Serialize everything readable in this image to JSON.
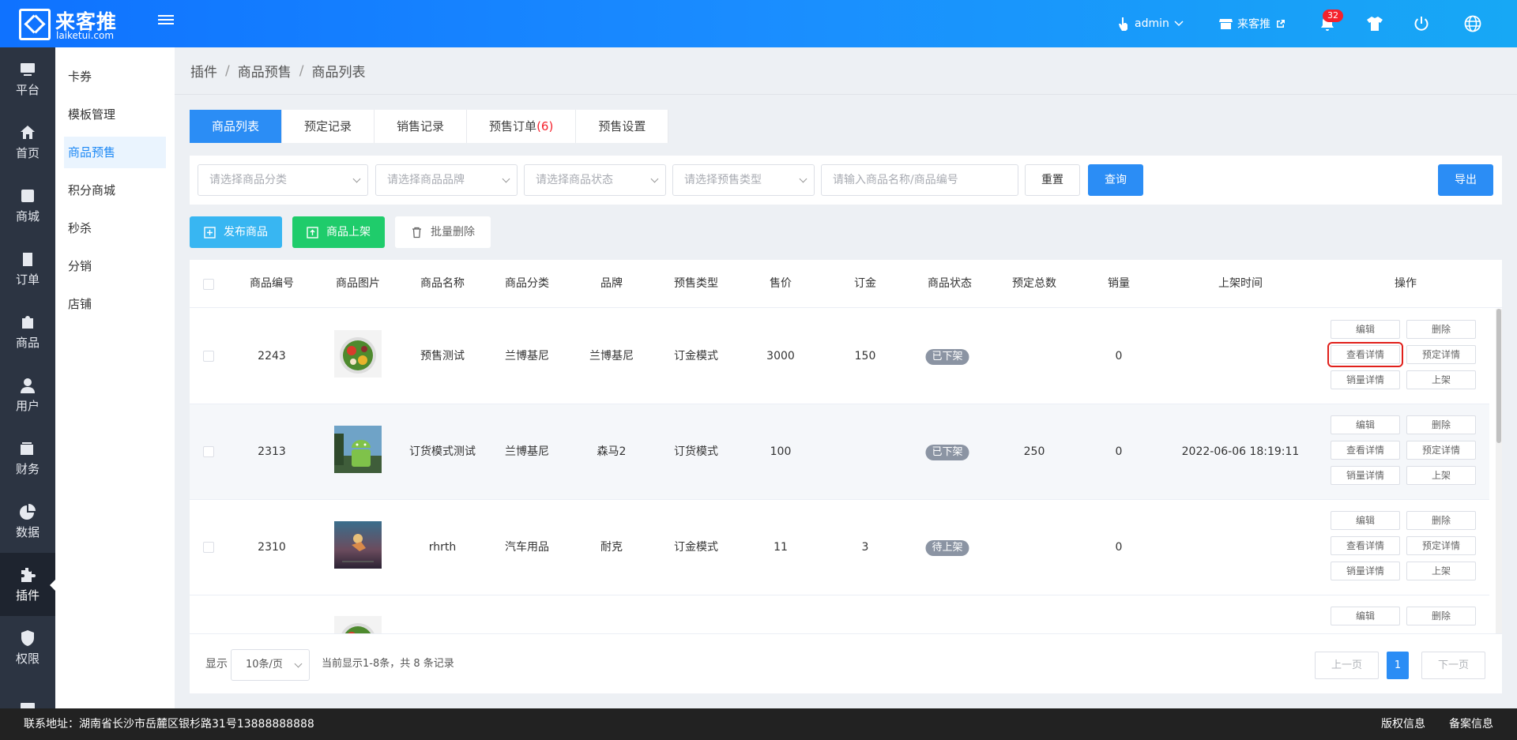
{
  "header": {
    "logo_cn": "来客推",
    "logo_en": "laiketui.com",
    "user": "admin",
    "store": "来客推",
    "notification_count": "32",
    "brand_gradient": [
      "#0f72ff",
      "#17a8f5"
    ]
  },
  "rail": [
    {
      "label": "平台",
      "icon": "platform-icon"
    },
    {
      "label": "首页",
      "icon": "home-icon"
    },
    {
      "label": "商城",
      "icon": "mall-icon"
    },
    {
      "label": "订单",
      "icon": "order-icon"
    },
    {
      "label": "商品",
      "icon": "goods-icon"
    },
    {
      "label": "用户",
      "icon": "user-icon"
    },
    {
      "label": "财务",
      "icon": "wallet-icon"
    },
    {
      "label": "数据",
      "icon": "pie-chart-icon"
    },
    {
      "label": "插件",
      "icon": "puzzle-icon"
    },
    {
      "label": "权限",
      "icon": "shield-icon"
    },
    {
      "label": "",
      "icon": "image-icon"
    }
  ],
  "submenu": [
    "卡券",
    "模板管理",
    "商品预售",
    "积分商城",
    "秒杀",
    "分销",
    "店铺"
  ],
  "breadcrumb": [
    "插件",
    "商品预售",
    "商品列表"
  ],
  "tabs": [
    {
      "label": "商品列表",
      "count": ""
    },
    {
      "label": "预定记录",
      "count": ""
    },
    {
      "label": "销售记录",
      "count": ""
    },
    {
      "label": "预售订单",
      "count": "(6)"
    },
    {
      "label": "预售设置",
      "count": ""
    }
  ],
  "filters": {
    "category": "请选择商品分类",
    "brand": "请选择商品品牌",
    "status": "请选择商品状态",
    "presale_type": "请选择预售类型",
    "keyword_placeholder": "请输入商品名称/商品编号",
    "reset": "重置",
    "query": "查询",
    "export": "导出"
  },
  "actions": {
    "publish": "发布商品",
    "shelve": "商品上架",
    "batch_delete": "批量删除"
  },
  "columns": [
    "商品编号",
    "商品图片",
    "商品名称",
    "商品分类",
    "品牌",
    "预售类型",
    "售价",
    "订金",
    "商品状态",
    "预定总数",
    "销量",
    "上架时间",
    "操作"
  ],
  "rows": [
    {
      "id": "2243",
      "name": "预售测试",
      "category": "兰博基尼",
      "brand": "兰博基尼",
      "type": "订金模式",
      "price": "3000",
      "deposit": "150",
      "status": "已下架",
      "reserved": "",
      "sales": "0",
      "time": "",
      "image": "salad-bowl"
    },
    {
      "id": "2313",
      "name": "订货模式测试",
      "category": "兰博基尼",
      "brand": "森马2",
      "type": "订货模式",
      "price": "100",
      "deposit": "",
      "status": "已下架",
      "reserved": "250",
      "sales": "0",
      "time": "2022-06-06 18:19:11",
      "image": "android-figure"
    },
    {
      "id": "2310",
      "name": "rhrth",
      "category": "汽车用品",
      "brand": "耐克",
      "type": "订金模式",
      "price": "11",
      "deposit": "3",
      "status": "待上架",
      "reserved": "",
      "sales": "0",
      "time": "",
      "image": "runner-photo"
    },
    {
      "id": "",
      "name": "",
      "category": "",
      "brand": "",
      "type": "",
      "price": "",
      "deposit": "",
      "status": "",
      "reserved": "",
      "sales": "",
      "time": "",
      "image": "salad-bowl"
    }
  ],
  "row_ops": [
    "编辑",
    "删除",
    "查看详情",
    "预定详情",
    "销量详情",
    "上架"
  ],
  "pagination": {
    "show_label": "显示",
    "page_size": "10条/页",
    "summary": "当前显示1-8条，共 8 条记录",
    "prev": "上一页",
    "current": "1",
    "next": "下一页"
  },
  "footer": {
    "address": "联系地址：湖南省长沙市岳麓区银杉路31号13888888888",
    "copyright": "版权信息",
    "record": "备案信息"
  }
}
